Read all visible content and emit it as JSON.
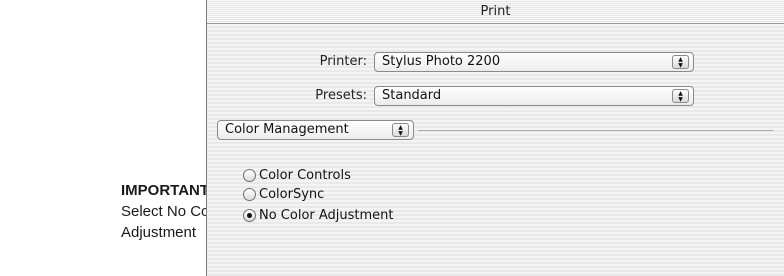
{
  "callout": {
    "title": "IMPORTANT!",
    "line1": "Select No Color",
    "line2": "Adjustment"
  },
  "window": {
    "title": "Print"
  },
  "printer": {
    "label": "Printer:",
    "value": "Stylus Photo 2200"
  },
  "presets": {
    "label": "Presets:",
    "value": "Standard"
  },
  "panel_menu": {
    "value": "Color Management"
  },
  "color_options": [
    {
      "label": "Color Controls",
      "selected": false
    },
    {
      "label": "ColorSync",
      "selected": false
    },
    {
      "label": "No Color Adjustment",
      "selected": true
    }
  ]
}
